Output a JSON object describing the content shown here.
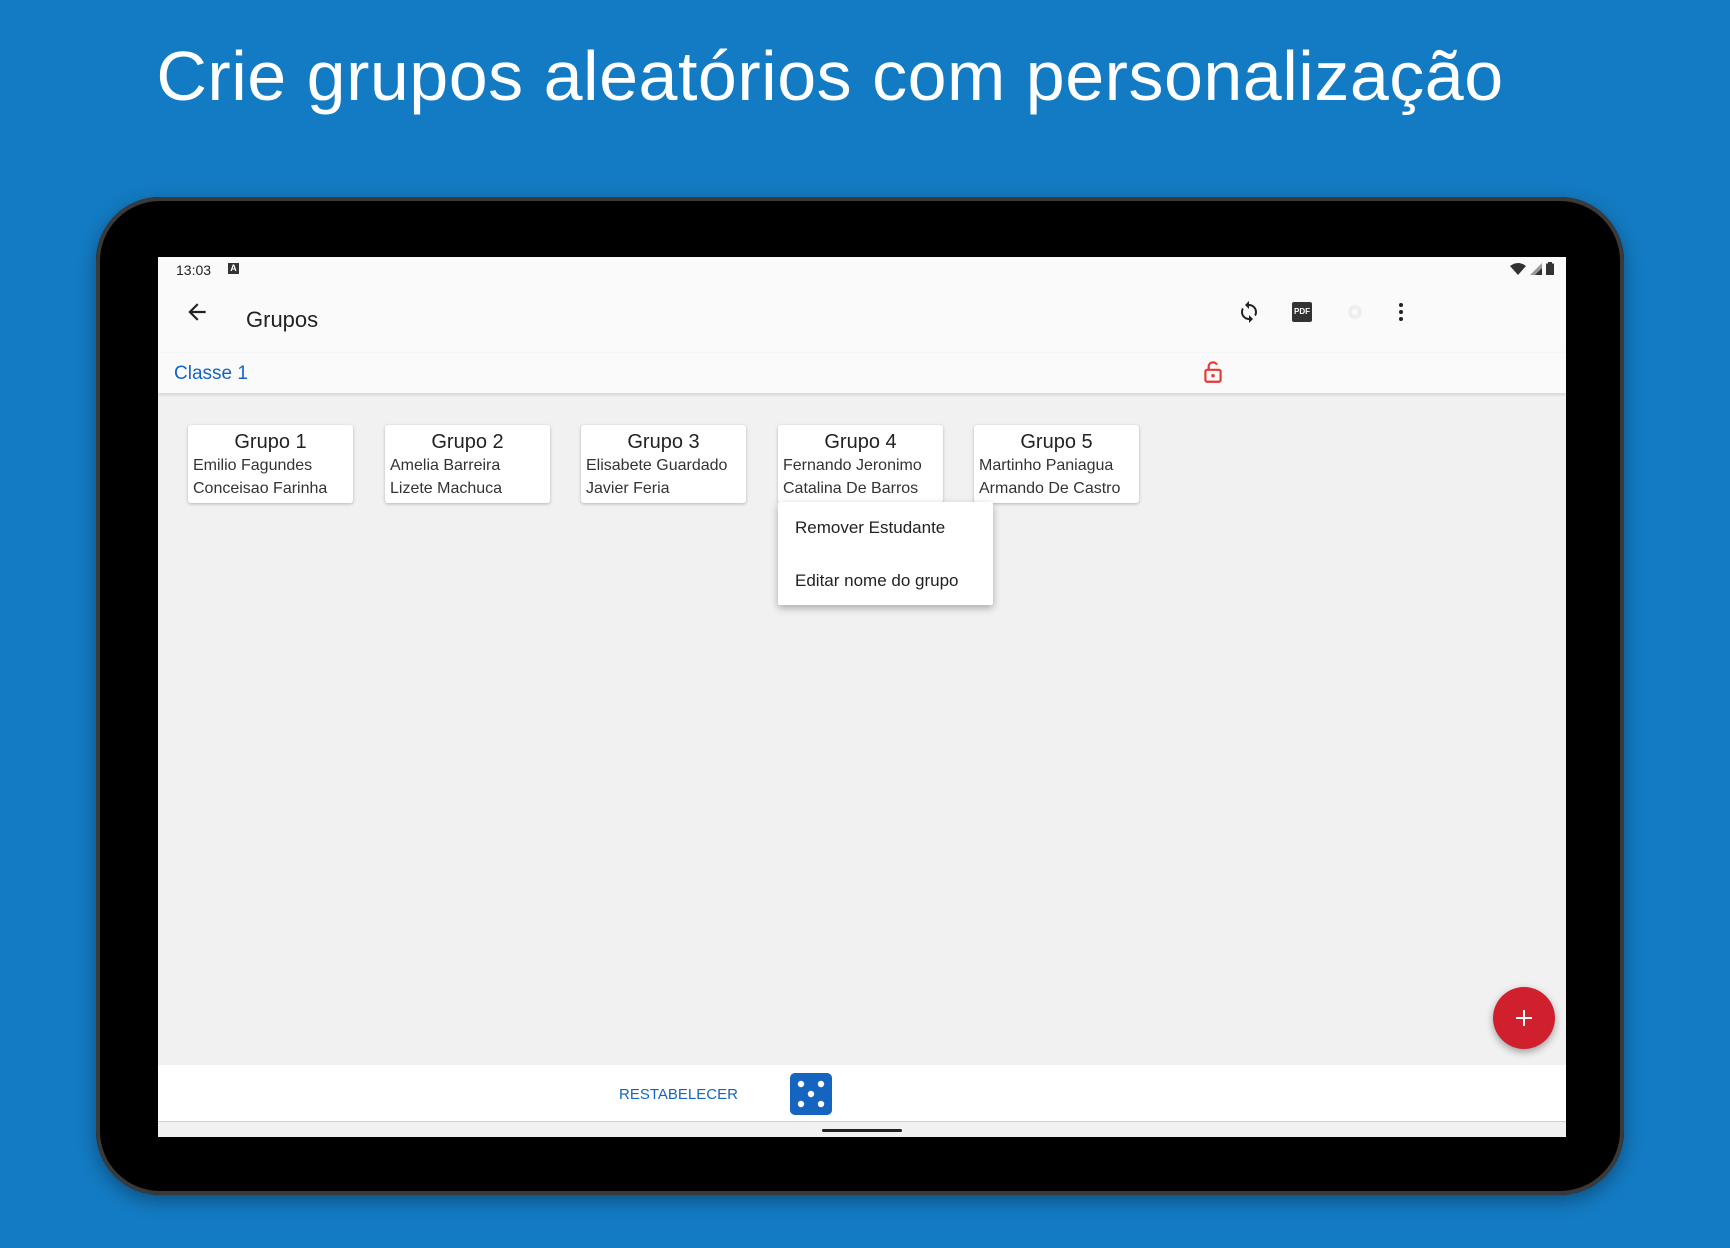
{
  "headline": "Crie grupos aleatórios com personalização",
  "status": {
    "time": "13:03",
    "notif_icon": "A"
  },
  "appbar": {
    "title": "Grupos",
    "back_icon": "arrow-left-icon",
    "actions": [
      "sync-icon",
      "pdf-icon",
      "settings-icon",
      "more-vert-icon"
    ],
    "pdf_label": "PDF"
  },
  "subbar": {
    "class_name": "Classe 1",
    "lock_icon": "unlock-icon",
    "lock_color": "#e53935"
  },
  "groups": [
    {
      "name": "Grupo  1",
      "students": [
        "Emilio Fagundes",
        "Conceisao Farinha"
      ]
    },
    {
      "name": "Grupo  2",
      "students": [
        "Amelia Barreira",
        "Lizete Machuca"
      ]
    },
    {
      "name": "Grupo  3",
      "students": [
        "Elisabete Guardado",
        "Javier Feria"
      ]
    },
    {
      "name": "Grupo  4",
      "students": [
        "Fernando Jeronimo",
        "Catalina De Barros"
      ]
    },
    {
      "name": "Grupo  5",
      "students": [
        "Martinho Paniagua",
        "Armando De Castro"
      ]
    }
  ],
  "context_menu": {
    "items": [
      "Remover Estudante",
      "Editar nome do grupo"
    ]
  },
  "fab": {
    "icon": "plus-icon",
    "color": "#d0202e"
  },
  "bottom": {
    "reset_label": "RESTABELECER",
    "dice_icon": "dice-icon",
    "accent": "#1565c0"
  }
}
